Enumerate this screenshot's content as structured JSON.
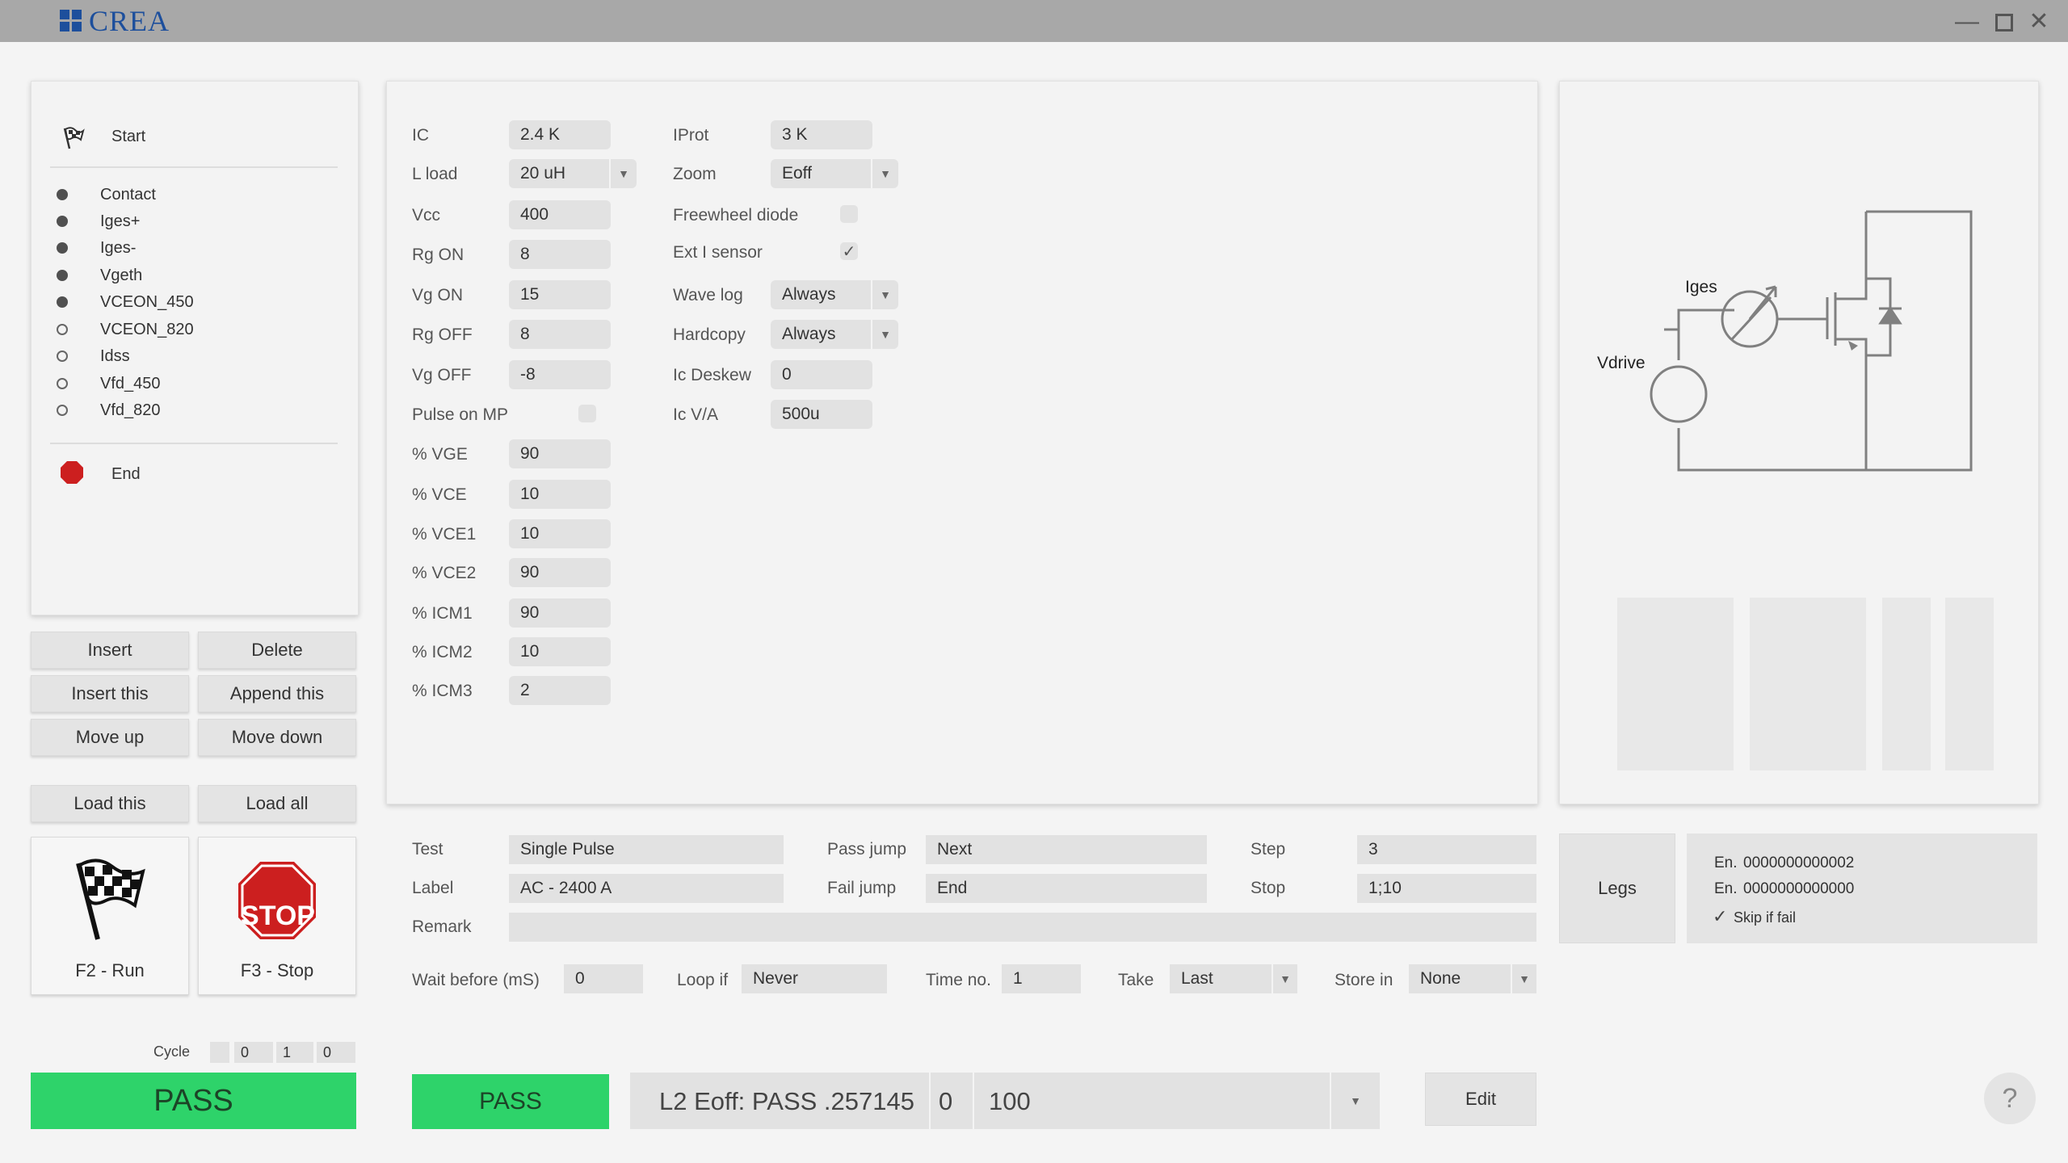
{
  "app": {
    "logo_text": "CREA",
    "brand_color": "#1d4f9c"
  },
  "window_controls": {
    "minimize": "―",
    "maximize": "■",
    "close": "✕"
  },
  "steps": [
    {
      "label": "Start",
      "icon": "checkered-flag-icon"
    },
    {
      "label": "Contact",
      "state": "filled"
    },
    {
      "label": "Iges+",
      "state": "filled"
    },
    {
      "label": "Iges-",
      "state": "filled"
    },
    {
      "label": "Vgeth",
      "state": "filled"
    },
    {
      "label": "VCEON_450",
      "state": "filled"
    },
    {
      "label": "VCEON_820",
      "state": "empty"
    },
    {
      "label": "Idss",
      "state": "empty"
    },
    {
      "label": "Vfd_450",
      "state": "empty"
    },
    {
      "label": "Vfd_820",
      "state": "empty"
    },
    {
      "label": "End",
      "icon": "stop-octagon-icon",
      "color": "#cc1f1f"
    }
  ],
  "list_buttons": {
    "insert": "Insert",
    "delete": "Delete",
    "insert_this": "Insert this",
    "append_this": "Append this",
    "move_up": "Move up",
    "move_down": "Move down",
    "load_this": "Load this",
    "load_all": "Load all"
  },
  "run": {
    "run_label": "F2 - Run",
    "stop_label": "F3 - Stop",
    "stop_sign_text": "STOP",
    "stop_color": "#cc1f1f"
  },
  "cycle": {
    "label": "Cycle",
    "values": [
      "",
      "0",
      "1",
      "0"
    ]
  },
  "result": {
    "pass_left": "PASS",
    "pass_mid": "PASS",
    "pass_color": "#2ed36a"
  },
  "params_left": [
    {
      "label": "IC",
      "value": "2.4 K"
    },
    {
      "label": "L load",
      "value": "20 uH",
      "select": true
    },
    {
      "label": "Vcc",
      "value": "400"
    },
    {
      "label": "Rg ON",
      "value": "8"
    },
    {
      "label": "Vg ON",
      "value": "15"
    },
    {
      "label": "Rg OFF",
      "value": "8"
    },
    {
      "label": "Vg OFF",
      "value": "-8"
    },
    {
      "label": "Pulse on MP",
      "checkbox": true,
      "checked": false
    },
    {
      "label": "% VGE",
      "value": "90"
    },
    {
      "label": "% VCE",
      "value": "10"
    },
    {
      "label": "% VCE1",
      "value": "10"
    },
    {
      "label": "% VCE2",
      "value": "90"
    },
    {
      "label": "% ICM1",
      "value": "90"
    },
    {
      "label": "% ICM2",
      "value": "10"
    },
    {
      "label": "% ICM3",
      "value": "2"
    }
  ],
  "params_right": [
    {
      "label": "IProt",
      "value": "3 K"
    },
    {
      "label": "Zoom",
      "value": "Eoff",
      "select": true
    },
    {
      "label": "Freewheel diode",
      "checkbox": true,
      "checked": false
    },
    {
      "label": "Ext I sensor",
      "checkbox": true,
      "checked": true
    },
    {
      "label": "Wave log",
      "value": "Always",
      "select": true
    },
    {
      "label": "Hardcopy",
      "value": "Always",
      "select": true
    },
    {
      "label": "Ic Deskew",
      "value": "0"
    },
    {
      "label": "Ic V/A",
      "value": "500u"
    }
  ],
  "circuit": {
    "label_iges": "Iges",
    "label_vdrive": "Vdrive"
  },
  "test_info": {
    "test_label": "Test",
    "test_value": "Single Pulse",
    "pass_jump_label": "Pass jump",
    "pass_jump_value": "Next",
    "step_label": "Step",
    "step_value": "3",
    "label_label": "Label",
    "label_value": "AC - 2400 A",
    "fail_jump_label": "Fail jump",
    "fail_jump_value": "End",
    "stop_label": "Stop",
    "stop_value": "1;10",
    "remark_label": "Remark",
    "remark_value": "",
    "wait_label": "Wait before (mS)",
    "wait_value": "0",
    "loop_label": "Loop if",
    "loop_value": "Never",
    "time_label": "Time no.",
    "time_value": "1",
    "take_label": "Take",
    "take_value": "Last",
    "store_label": "Store in",
    "store_value": "None"
  },
  "legs": {
    "button": "Legs",
    "en1_label": "En.",
    "en1_value": "0000000000002",
    "en2_label": "En.",
    "en2_value": "0000000000000",
    "skip_label": "Skip if fail",
    "skip_checked": true
  },
  "status": {
    "message": "L2 Eoff: PASS .257145",
    "field2": "0",
    "field3": "100"
  },
  "edit_button": "Edit",
  "help": "?"
}
